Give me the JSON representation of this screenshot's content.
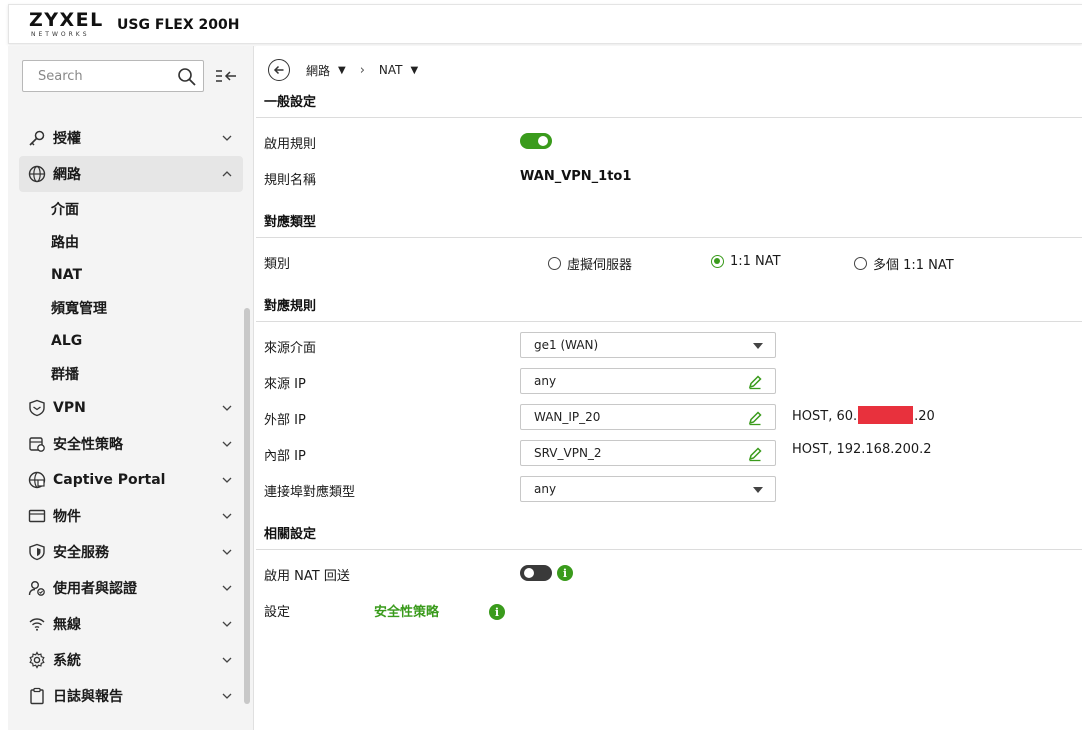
{
  "app": {
    "brand": "ZYXEL",
    "brand_sub": "NETWORKS",
    "model": "USG FLEX 200H"
  },
  "sidebar": {
    "search_placeholder": "Search",
    "items": [
      {
        "label": "授權",
        "icon": "key-icon"
      },
      {
        "label": "網路",
        "icon": "globe-icon",
        "expanded": true,
        "children": [
          "介面",
          "路由",
          "NAT",
          "頻寬管理",
          "ALG",
          "群播"
        ]
      },
      {
        "label": "VPN",
        "icon": "shield-vpn-icon"
      },
      {
        "label": "安全性策略",
        "icon": "policy-icon"
      },
      {
        "label": "Captive Portal",
        "icon": "portal-globe-icon"
      },
      {
        "label": "物件",
        "icon": "object-card-icon"
      },
      {
        "label": "安全服務",
        "icon": "security-shield-icon"
      },
      {
        "label": "使用者與認證",
        "icon": "user-auth-icon"
      },
      {
        "label": "無線",
        "icon": "wifi-icon"
      },
      {
        "label": "系統",
        "icon": "gear-icon"
      },
      {
        "label": "日誌與報告",
        "icon": "clipboard-icon"
      }
    ]
  },
  "breadcrumb": {
    "level1": "網路",
    "level2": "NAT"
  },
  "form": {
    "general": {
      "title": "一般設定",
      "enable_label": "啟用規則",
      "enable_on": true,
      "name_label": "規則名稱",
      "name_value": "WAN_VPN_1to1"
    },
    "mapping_type": {
      "title": "對應類型",
      "type_label": "類別",
      "options": [
        "虛擬伺服器",
        "1:1 NAT",
        "多個 1:1 NAT"
      ],
      "selected": "1:1 NAT"
    },
    "mapping_rule": {
      "title": "對應規則",
      "src_if_label": "來源介面",
      "src_if_value": "ge1 (WAN)",
      "src_ip_label": "來源 IP",
      "src_ip_value": "any",
      "ext_ip_label": "外部 IP",
      "ext_ip_value": "WAN_IP_20",
      "ext_host_prefix": "HOST, 60.",
      "ext_host_suffix": ".20",
      "int_ip_label": "內部 IP",
      "int_ip_value": "SRV_VPN_2",
      "int_host": "HOST, 192.168.200.2",
      "port_type_label": "連接埠對應類型",
      "port_type_value": "any"
    },
    "related": {
      "title": "相關設定",
      "loopback_label": "啟用 NAT 回送",
      "loopback_on": false,
      "settings_label": "設定",
      "settings_link": "安全性策略"
    }
  },
  "colors": {
    "accent_green": "#3a9b1c",
    "redaction": "#e8313d",
    "sidebar_bg": "#f4f4f4"
  }
}
